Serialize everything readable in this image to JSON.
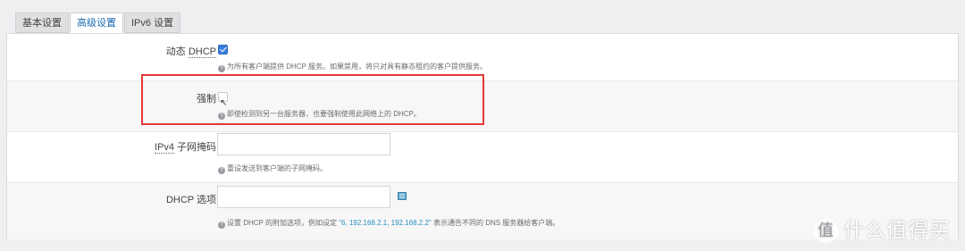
{
  "tabs": [
    {
      "label": "基本设置",
      "active": false
    },
    {
      "label": "高级设置",
      "active": true
    },
    {
      "label": "IPv6 设置",
      "active": false
    }
  ],
  "rows": {
    "dynamic_dhcp": {
      "label_prefix": "动态 ",
      "label_link": "DHCP",
      "checked": true,
      "hint": "为所有客户端提供 DHCP 服务。如果禁用，将只对具有静态租约的客户提供服务。"
    },
    "force": {
      "label": "强制",
      "checked": false,
      "hint": "即使检测到另一台服务器，也要强制使用此网络上的 DHCP。"
    },
    "ipv4_netmask": {
      "label_link": "IPv4",
      "label_suffix": " 子网掩码",
      "value": "",
      "hint": "重设发送到客户端的子网掩码。"
    },
    "dhcp_options": {
      "label": "DHCP 选项",
      "value": "",
      "hint_prefix": "设置 DHCP 的附加选项，例如设定 ",
      "hint_code": "\"6, 192.168.2.1, 192.168.2.2\"",
      "hint_suffix": " 表示通告不同的 DNS 服务器给客户端。"
    }
  },
  "icons": {
    "help": "help-icon",
    "add": "add-list-icon"
  },
  "colors": {
    "accent": "#3b7dd8",
    "highlight": "#e53935",
    "link": "#2b8fc4"
  },
  "watermark": {
    "logo_char": "值",
    "text": "什么值得买"
  }
}
